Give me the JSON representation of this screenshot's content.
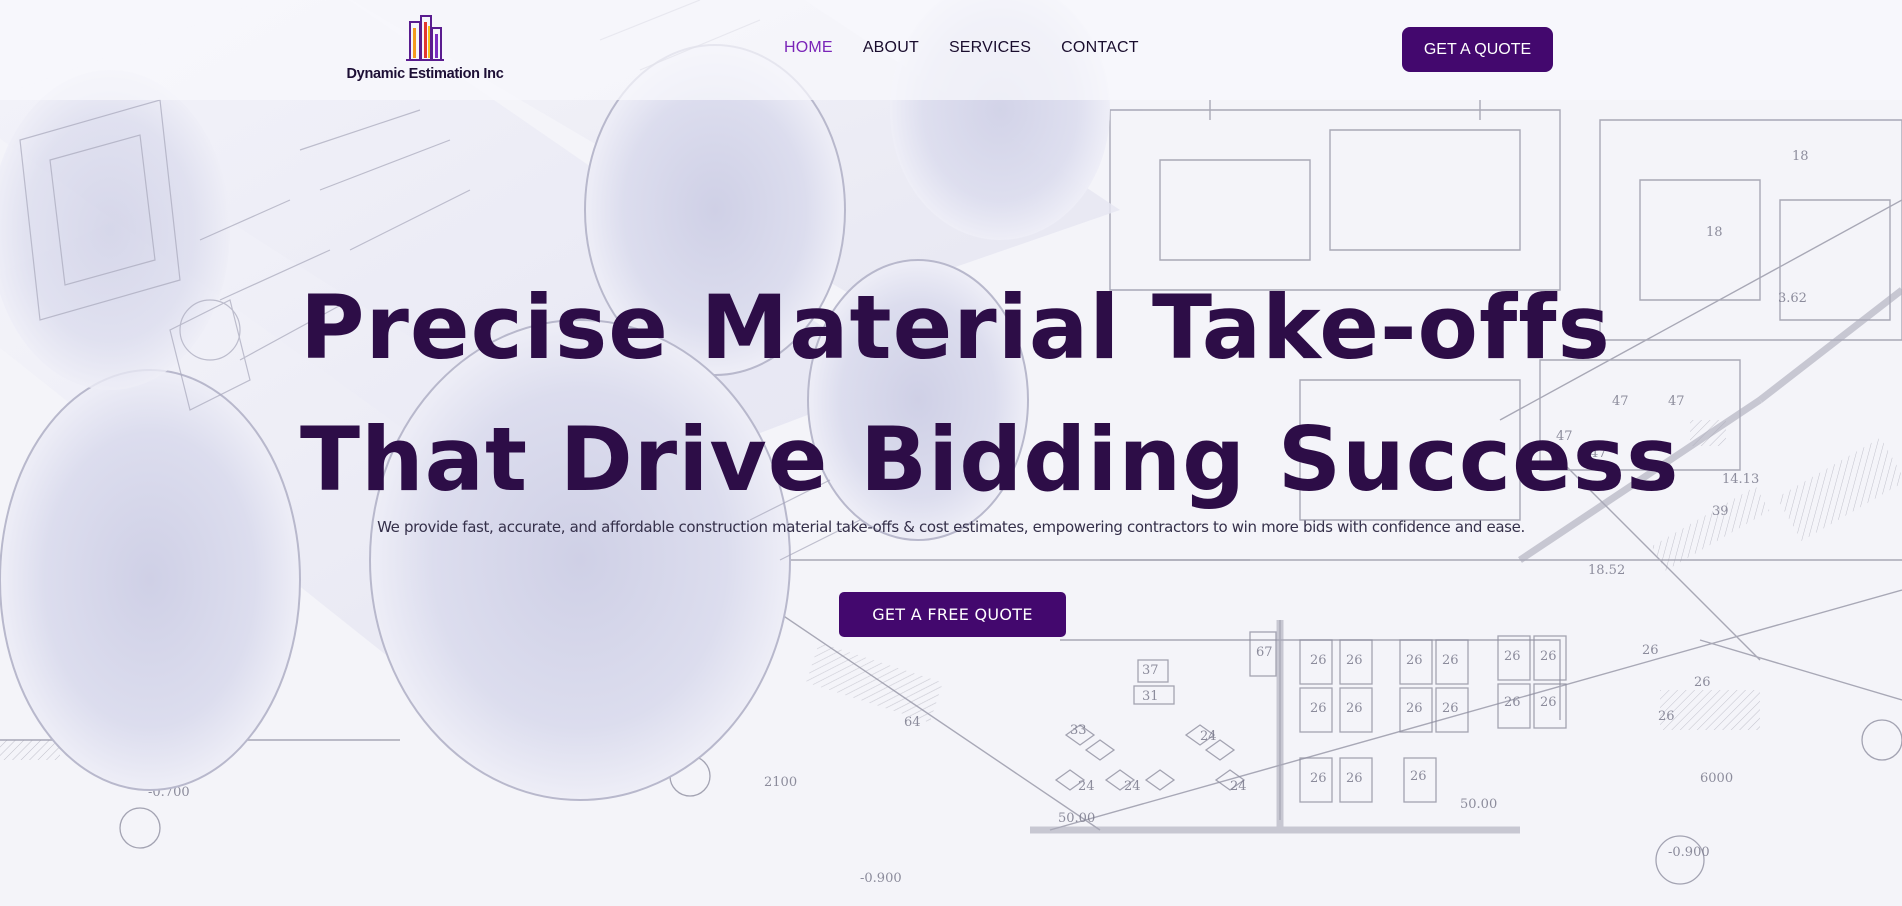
{
  "brand": {
    "name": "Dynamic Estimation Inc"
  },
  "nav": {
    "items": [
      {
        "label": "HOME",
        "active": true
      },
      {
        "label": "ABOUT",
        "active": false
      },
      {
        "label": "SERVICES",
        "active": false
      },
      {
        "label": "CONTACT",
        "active": false
      }
    ],
    "cta_label": "GET A QUOTE"
  },
  "hero": {
    "title_line1": "Precise Material Take-offs",
    "title_line2": "That Drive Bidding Success",
    "subtitle": "We provide fast, accurate, and affordable construction material take-offs & cost estimates, empowering contractors to win more bids with confidence and ease.",
    "cta_label": "GET A FREE QUOTE"
  },
  "background": {
    "type": "architectural-blueprint-photo",
    "plan_labels": [
      "47",
      "26",
      "24",
      "14.13",
      "18.52",
      "50.00",
      "-0.700",
      "-0.900",
      "6000",
      "2100",
      "37",
      "31",
      "33",
      "39",
      "64",
      "67"
    ]
  },
  "colors": {
    "primary": "#43086e",
    "heading": "#2d0d47",
    "nav_active": "#7a24b8",
    "nav_text": "#1a0d2e",
    "background": "#f3f3f8"
  }
}
